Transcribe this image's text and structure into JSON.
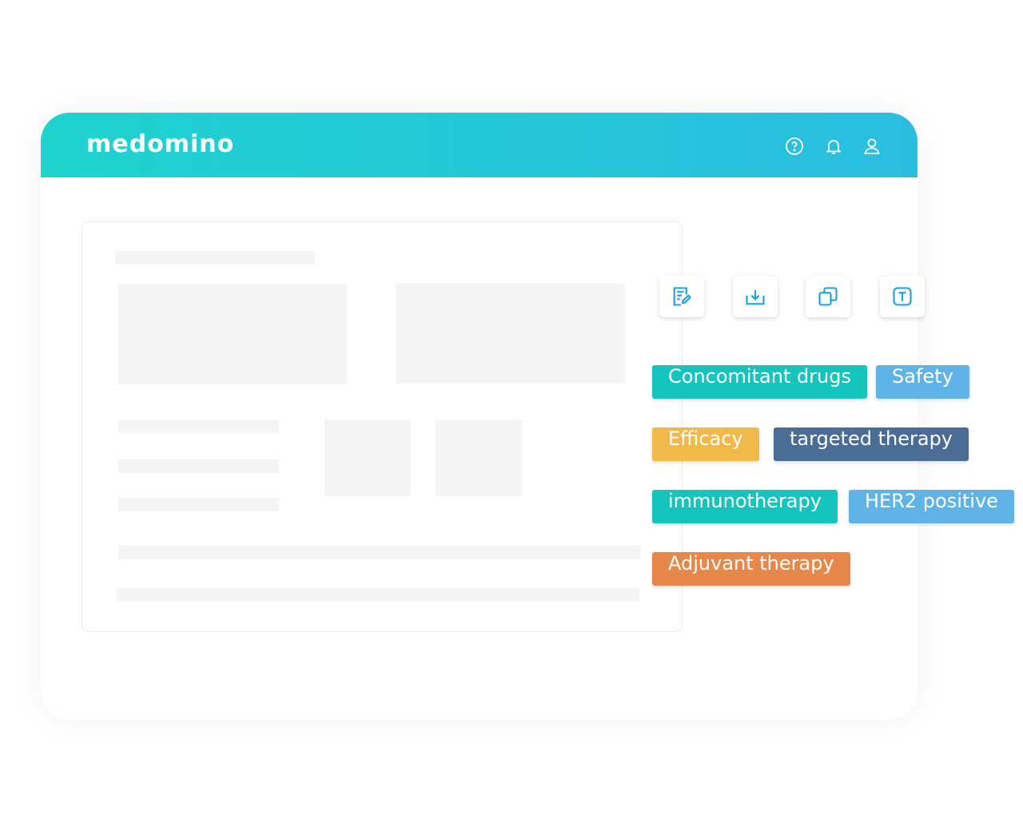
{
  "header": {
    "logo": "medomino",
    "icons": [
      "help-icon",
      "bell-icon",
      "user-icon"
    ]
  },
  "actions": [
    "edit-note-icon",
    "download-icon",
    "copy-icon",
    "text-icon"
  ],
  "accent": "#1a9fe0",
  "tags": [
    {
      "label": "Concomitant drugs",
      "color": "#14c4bd"
    },
    {
      "label": "Safety",
      "color": "#5fb3e6"
    },
    {
      "label": "Efficacy",
      "color": "#f1b84a"
    },
    {
      "label": "targeted therapy",
      "color": "#4a6d96"
    },
    {
      "label": "immunotherapy",
      "color": "#14c4bd"
    },
    {
      "label": "HER2 positive",
      "color": "#5fb3e6"
    },
    {
      "label": "Adjuvant therapy",
      "color": "#e8874a"
    }
  ]
}
